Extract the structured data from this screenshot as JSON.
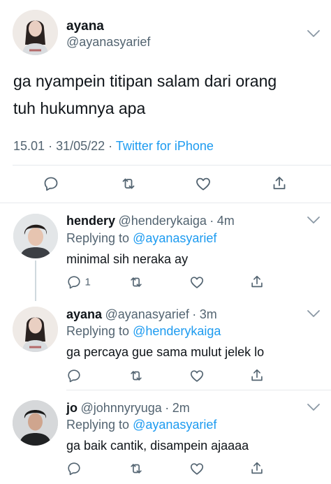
{
  "main_tweet": {
    "display_name": "ayana",
    "handle": "@ayanasyarief",
    "text_line1": "ga nyampein titipan salam dari orang",
    "text_line2": "tuh hukumnya apa",
    "time": "15.01",
    "separator": "·",
    "date": "31/05/22",
    "source": "Twitter for iPhone"
  },
  "replies": [
    {
      "display_name": "hendery",
      "handle": "@henderykaiga",
      "separator": "·",
      "age": "4m",
      "replying_prefix": "Replying to",
      "replying_to": "@ayanasyarief",
      "text": "minimal sih neraka ay",
      "reply_count": "1"
    },
    {
      "display_name": "ayana",
      "handle": "@ayanasyarief",
      "separator": "·",
      "age": "3m",
      "replying_prefix": "Replying to",
      "replying_to": "@henderykaiga",
      "text": "ga percaya gue sama mulut jelek lo",
      "reply_count": ""
    },
    {
      "display_name": "jo",
      "handle": "@johnnyryuga",
      "separator": "·",
      "age": "2m",
      "replying_prefix": "Replying to",
      "replying_to": "@ayanasyarief",
      "text": "ga baik cantik, disampein ajaaaa",
      "reply_count": ""
    }
  ],
  "colors": {
    "text": "#0f1419",
    "secondary": "#536471",
    "link": "#1d9bf0",
    "divider": "#e6e9ec"
  },
  "icons": [
    "chevron-down-icon",
    "reply-icon",
    "retweet-icon",
    "like-icon",
    "share-icon"
  ]
}
